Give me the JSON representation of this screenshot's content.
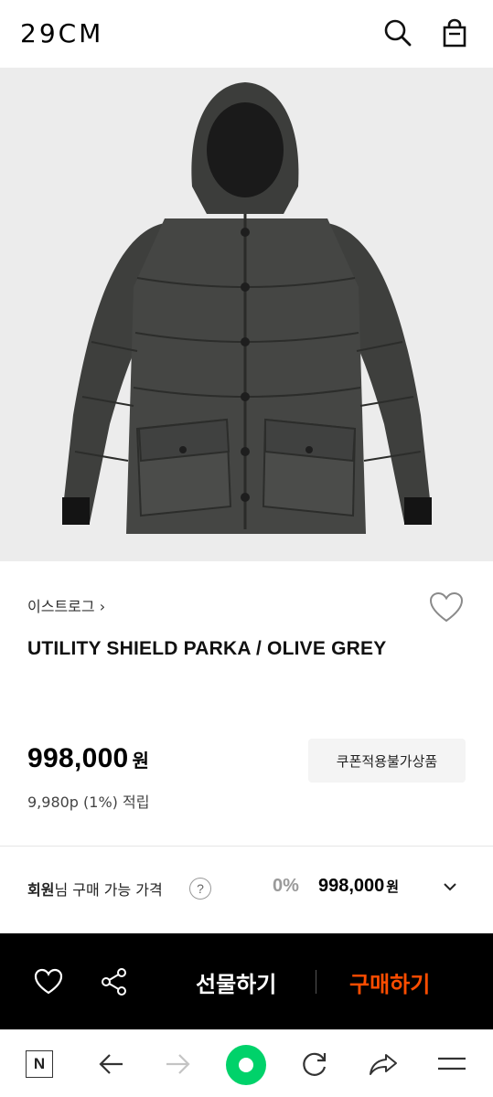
{
  "header": {
    "logo": "29CM",
    "icons": [
      "search-icon",
      "shopping-bag-icon"
    ]
  },
  "product": {
    "image_subject": "grey hooded down parka",
    "brand": "이스트로그",
    "brand_chevron": "›",
    "title": "UTILITY SHIELD PARKA / OLIVE GREY",
    "price": "998,000",
    "price_unit": "원",
    "points": "9,980p (1%) 적립",
    "coupon_badge": "쿠폰적용불가상품"
  },
  "member": {
    "label_bold": "회원",
    "label_rest": "님 구매 가능 가격",
    "help": "?",
    "discount": "0%",
    "price": "998,000",
    "price_unit": "원"
  },
  "buybar": {
    "gift_label": "선물하기",
    "buy_label": "구매하기",
    "buy_color": "#ff4d00"
  },
  "navbar": {
    "n_label": "N",
    "accent": "#00d26a",
    "icons": [
      "n-home-icon",
      "back-arrow-icon",
      "forward-arrow-icon",
      "green-circle-icon",
      "refresh-icon",
      "share-arrow-icon",
      "menu-icon"
    ]
  }
}
